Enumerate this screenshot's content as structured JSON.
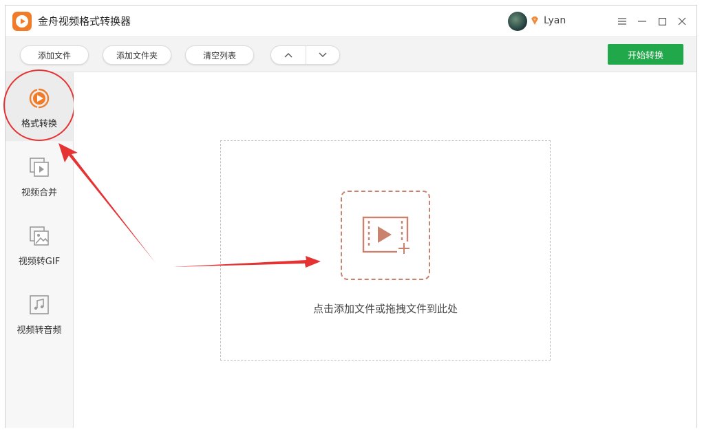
{
  "app": {
    "title": "金舟视频格式转换器"
  },
  "user": {
    "name": "Lyan"
  },
  "toolbar": {
    "add_file": "添加文件",
    "add_folder": "添加文件夹",
    "clear_list": "清空列表",
    "start": "开始转换"
  },
  "sidebar": {
    "items": [
      {
        "label": "格式转换",
        "icon": "play-circle-icon",
        "active": true
      },
      {
        "label": "视频合并",
        "icon": "video-merge-icon",
        "active": false
      },
      {
        "label": "视频转GIF",
        "icon": "image-gif-icon",
        "active": false
      },
      {
        "label": "视频转音频",
        "icon": "music-note-icon",
        "active": false
      }
    ]
  },
  "dropzone": {
    "hint": "点击添加文件或拖拽文件到此处"
  },
  "colors": {
    "accent_orange": "#f07c2a",
    "start_green": "#21a84a",
    "annotation_red": "#e53232",
    "dropzone_icon": "#c9826e"
  }
}
